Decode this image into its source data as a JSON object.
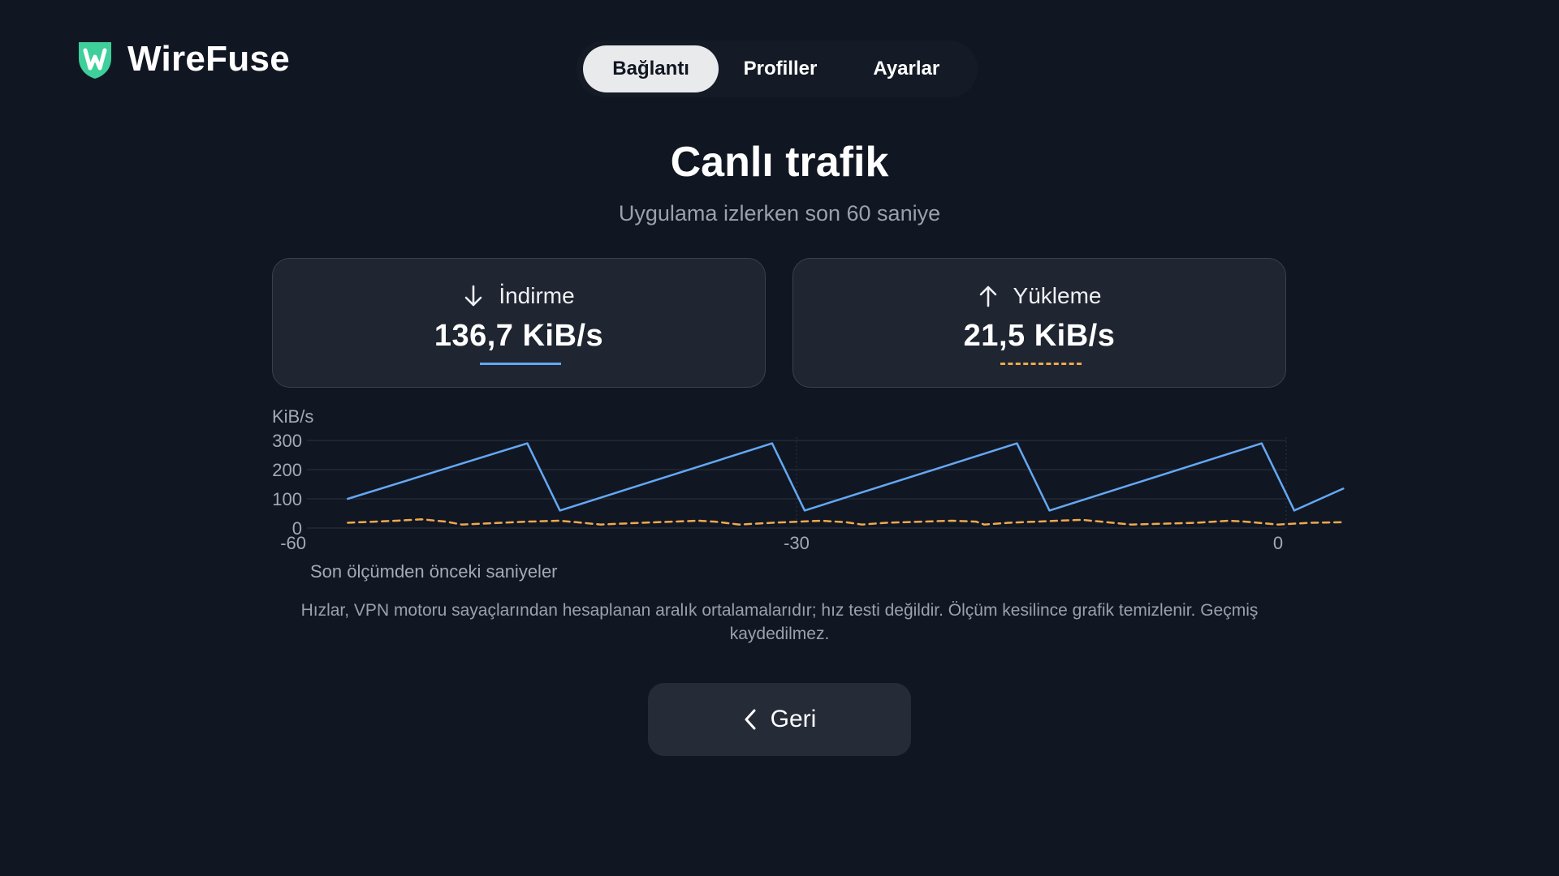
{
  "brand": {
    "name": "WireFuse",
    "accent": "#3ecf9a"
  },
  "tabs": [
    {
      "label": "Bağlantı",
      "active": true
    },
    {
      "label": "Profiller",
      "active": false
    },
    {
      "label": "Ayarlar",
      "active": false
    }
  ],
  "title": "Canlı trafik",
  "subtitle": "Uygulama izlerken son 60 saniye",
  "download": {
    "label": "İndirme",
    "value": "136,7 KiB/s",
    "icon": "arrow-down-icon",
    "color": "#64a8f5"
  },
  "upload": {
    "label": "Yükleme",
    "value": "21,5 KiB/s",
    "icon": "arrow-up-icon",
    "color": "#f0a84e"
  },
  "note": "Hızlar, VPN motoru sayaçlarından hesaplanan aralık ortalamalarıdır; hız testi değildir. Ölçüm kesilince grafik temizlenir. Geçmiş kaydedilmez.",
  "back_button": {
    "label": "Geri",
    "icon": "chevron-left-icon"
  },
  "chart_data": {
    "type": "line",
    "ylabel": "KiB/s",
    "xlabel": "Son ölçümden önceki saniyeler",
    "xlim": [
      -60,
      0
    ],
    "ylim": [
      0,
      300
    ],
    "yticks": [
      "300",
      "200",
      "100",
      "0"
    ],
    "xticks": [
      "-60",
      "-30",
      "0"
    ],
    "grid": true,
    "series": [
      {
        "style": "solid",
        "color": "#64a8f5",
        "x": [
          -57.5,
          -46.5,
          -44.5,
          -31.5,
          -29.5,
          -16.5,
          -14.5,
          -1.5,
          0.5,
          3.5
        ],
        "y": [
          100,
          290,
          60,
          290,
          60,
          290,
          60,
          290,
          60,
          135
        ]
      },
      {
        "style": "dashed",
        "color": "#f0a84e",
        "x": [
          -57.5,
          -54.5,
          -53.0,
          -51.5,
          -50.5,
          -46.5,
          -44.5,
          -43.5,
          -42.0,
          -39.5,
          -36.0,
          -35.0,
          -33.5,
          -31.5,
          -28.5,
          -27.0,
          -26.0,
          -24.5,
          -20.5,
          -19.0,
          -18.5,
          -17.0,
          -14.0,
          -12.5,
          -11.0,
          -9.5,
          -5.5,
          -3.5,
          -2.5,
          -0.5,
          1.5,
          3.5
        ],
        "y": [
          18,
          25,
          30,
          22,
          12,
          22,
          25,
          20,
          12,
          18,
          25,
          22,
          12,
          18,
          25,
          20,
          12,
          18,
          25,
          22,
          12,
          18,
          25,
          28,
          20,
          12,
          18,
          25,
          22,
          12,
          18,
          20
        ]
      }
    ]
  }
}
